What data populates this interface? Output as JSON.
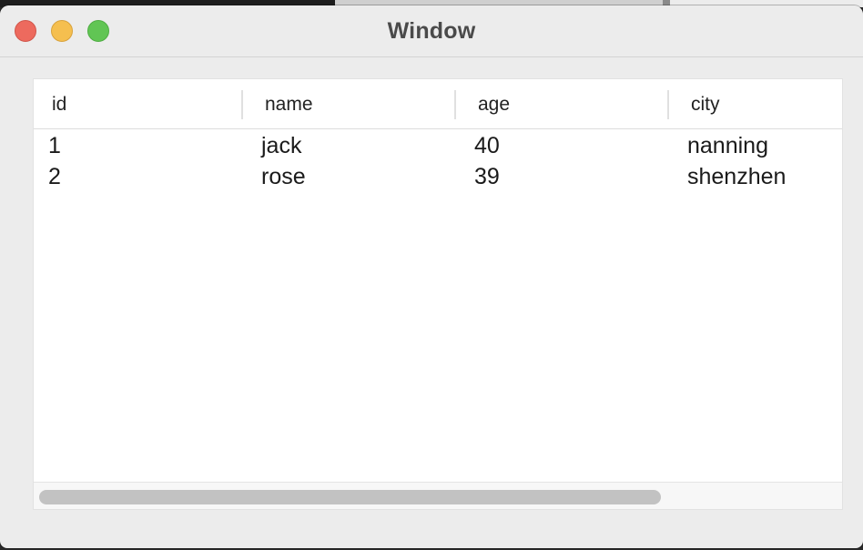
{
  "window": {
    "title": "Window"
  },
  "table": {
    "columns": [
      "id",
      "name",
      "age",
      "city"
    ],
    "rows": [
      [
        "1",
        "jack",
        "40",
        "nanning"
      ],
      [
        "2",
        "rose",
        "39",
        "shenzhen"
      ]
    ]
  },
  "scrollbar": {
    "horizontal_visible_fraction": 0.78
  },
  "colors": {
    "close": "#ed6a5e",
    "minimize": "#f5bf4f",
    "zoom": "#61c554"
  }
}
